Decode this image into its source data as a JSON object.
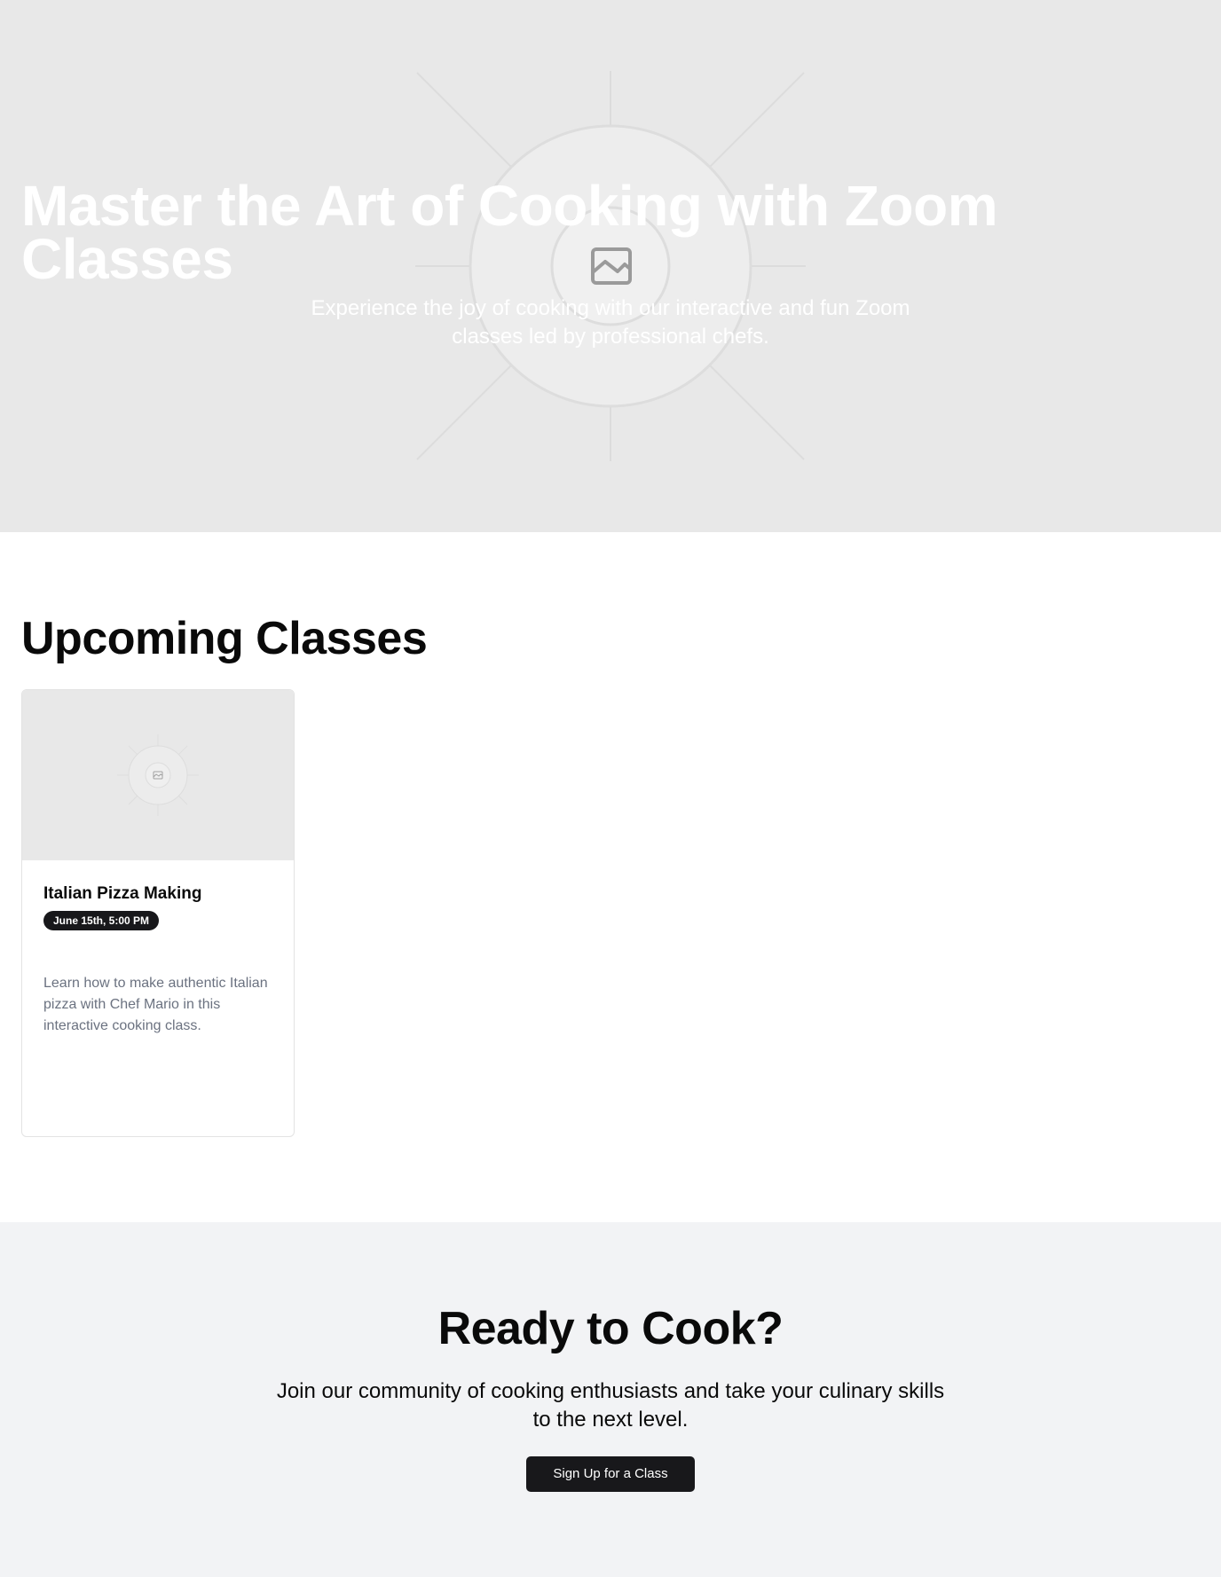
{
  "hero": {
    "title": "Master the Art of Cooking with Zoom Classes",
    "subtitle": "Experience the joy of cooking with our interactive and fun Zoom classes led by professional chefs.",
    "image_icon": "image-placeholder-icon"
  },
  "upcoming": {
    "title": "Upcoming Classes",
    "classes": [
      {
        "title": "Italian Pizza Making",
        "date": "June 15th, 5:00 PM",
        "description": "Learn how to make authentic Italian pizza with Chef Mario in this interactive cooking class.",
        "image_icon": "image-placeholder-icon"
      }
    ]
  },
  "cta": {
    "title": "Ready to Cook?",
    "text": "Join our community of cooking enthusiasts and take your culinary skills to the next level.",
    "button_label": "Sign Up for a Class"
  },
  "colors": {
    "hero_bg": "#e8e8e8",
    "cta_bg": "#f2f3f5",
    "primary_dark": "#18181b",
    "muted_text": "#6b7280"
  }
}
